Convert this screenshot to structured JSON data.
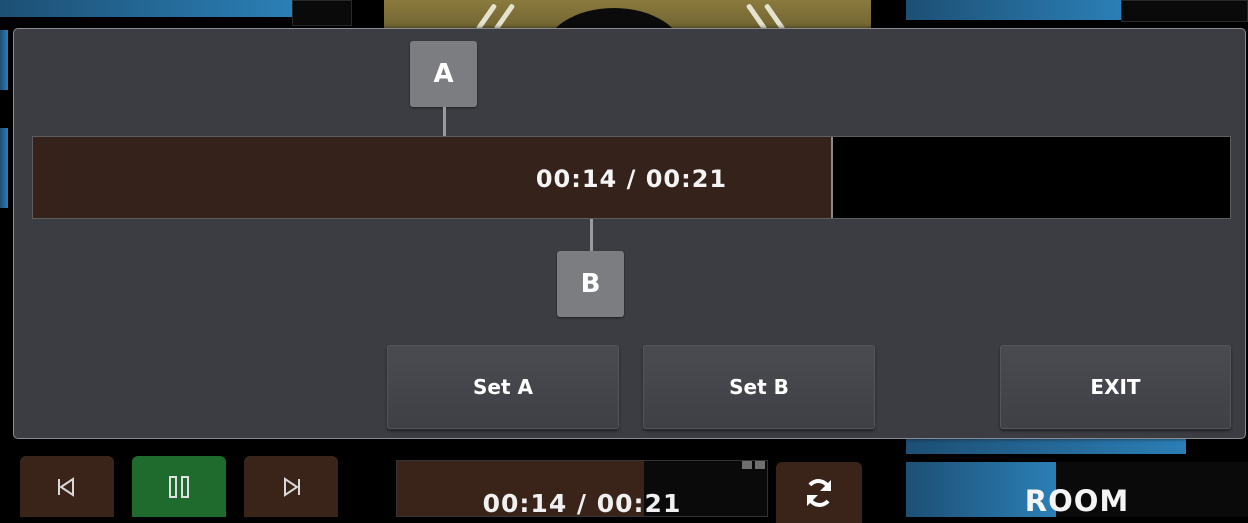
{
  "dialog": {
    "marker_a": "A",
    "marker_b": "B",
    "time_text": "00:14 / 00:21",
    "progress_fraction": 0.6667,
    "buttons": {
      "set_a": "Set A",
      "set_b": "Set B",
      "exit": "EXIT"
    }
  },
  "player": {
    "time_text": "00:14 / 00:21",
    "progress_fraction": 0.6667,
    "room_label": "ROOM"
  },
  "icons": {
    "previous": "skip-previous-icon",
    "pause": "pause-icon",
    "next": "skip-next-icon",
    "repeat": "repeat-icon"
  },
  "colors": {
    "dialog_bg": "#3c3d42",
    "progress_fill": "#35231b",
    "play_active": "#1f6a2d",
    "accent_blue": "#2b7fb6"
  }
}
